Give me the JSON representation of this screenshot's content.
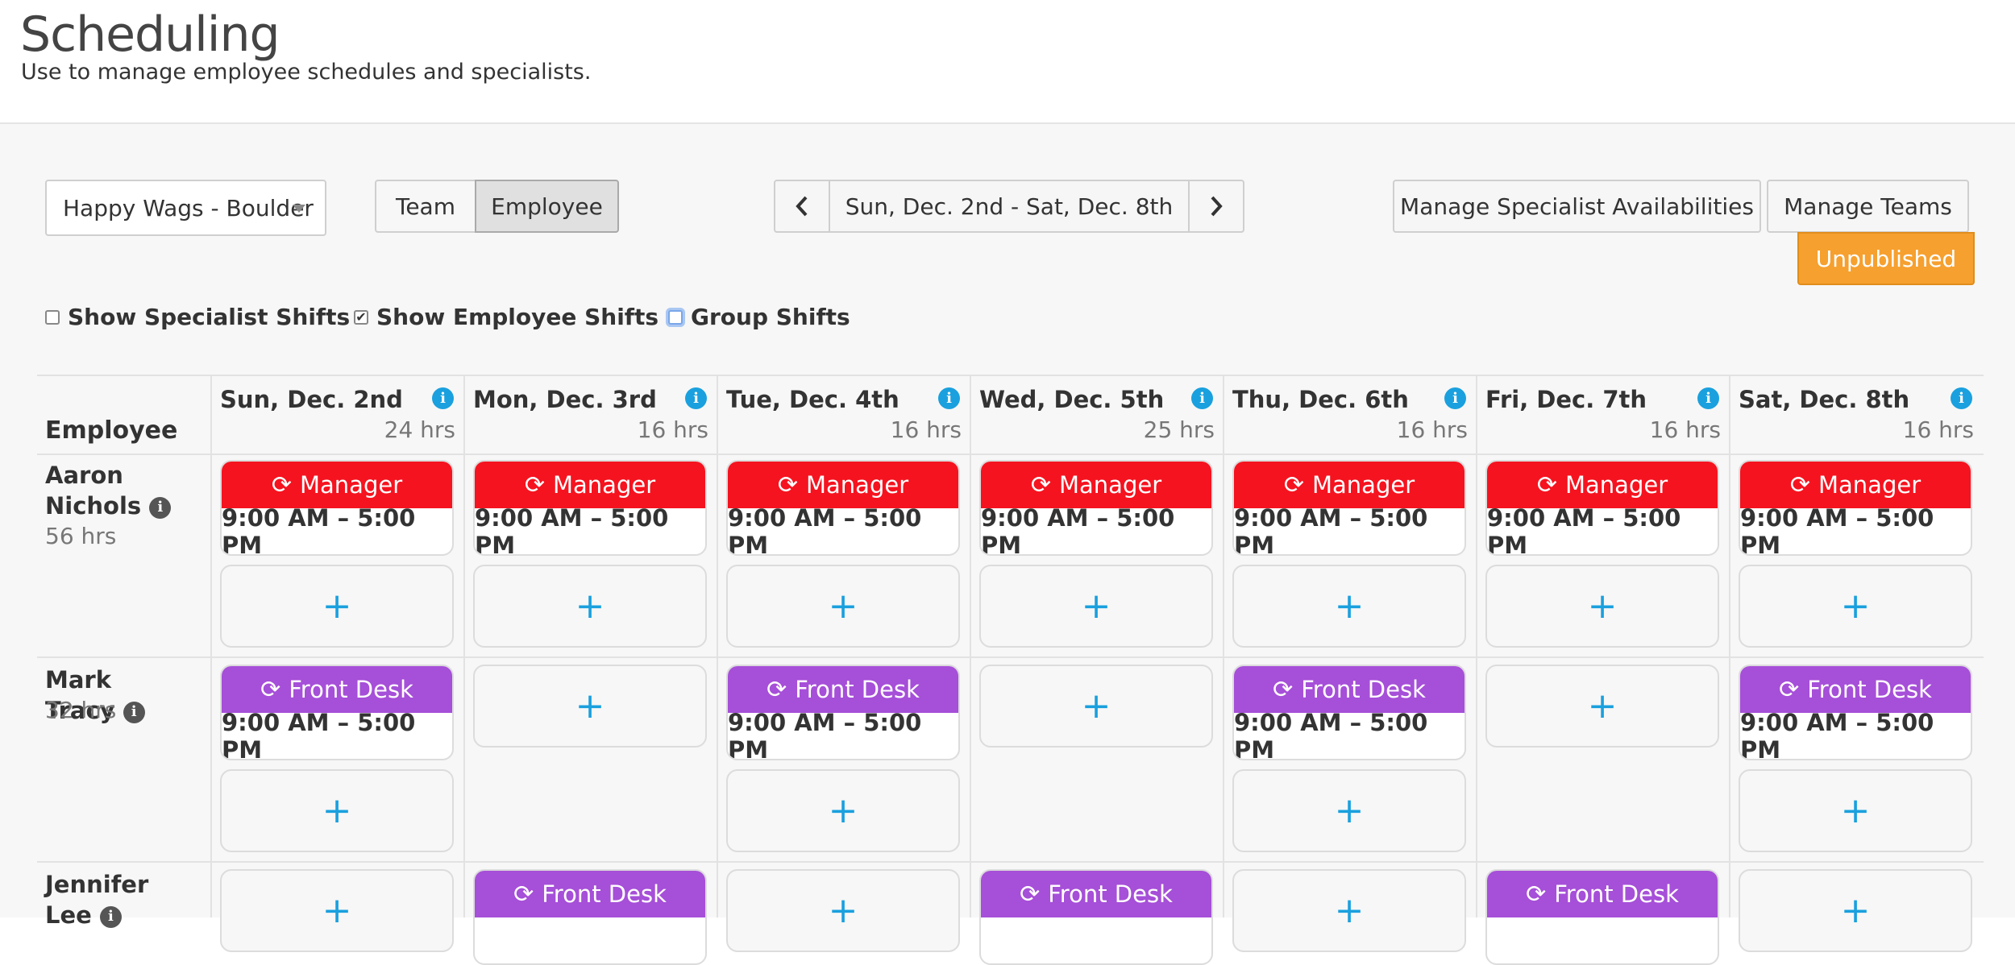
{
  "header": {
    "title": "Scheduling",
    "subtitle": "Use to manage employee schedules and specialists."
  },
  "controls": {
    "location": "Happy Wags - Boulder",
    "view_toggle": [
      "Team",
      "Employee"
    ],
    "active_view": "Employee",
    "date_range": "Sun, Dec. 2nd - Sat, Dec. 8th",
    "manage_specialist": "Manage Specialist Availabilities",
    "manage_teams": "Manage Teams",
    "status": "Unpublished"
  },
  "filters": [
    {
      "label": "Show Specialist Shifts",
      "checked": false
    },
    {
      "label": "Show Employee Shifts",
      "checked": true
    },
    {
      "label": "Group Shifts",
      "checked": false
    }
  ],
  "grid": {
    "employee_header": "Employee",
    "days": [
      {
        "label": "Sun, Dec. 2nd",
        "hours": "24 hrs"
      },
      {
        "label": "Mon, Dec. 3rd",
        "hours": "16 hrs"
      },
      {
        "label": "Tue, Dec. 4th",
        "hours": "16 hrs"
      },
      {
        "label": "Wed, Dec. 5th",
        "hours": "25 hrs"
      },
      {
        "label": "Thu, Dec. 6th",
        "hours": "16 hrs"
      },
      {
        "label": "Fri, Dec. 7th",
        "hours": "16 hrs"
      },
      {
        "label": "Sat, Dec. 8th",
        "hours": "16 hrs"
      }
    ],
    "rows": [
      {
        "name": "Aaron Nichols",
        "hours": "56 hrs",
        "shifts": [
          {
            "role": "Manager",
            "time": "9:00 AM – 5:00 PM"
          },
          {
            "role": "Manager",
            "time": "9:00 AM – 5:00 PM"
          },
          {
            "role": "Manager",
            "time": "9:00 AM – 5:00 PM"
          },
          {
            "role": "Manager",
            "time": "9:00 AM – 5:00 PM"
          },
          {
            "role": "Manager",
            "time": "9:00 AM – 5:00 PM"
          },
          {
            "role": "Manager",
            "time": "9:00 AM – 5:00 PM"
          },
          {
            "role": "Manager",
            "time": "9:00 AM – 5:00 PM"
          }
        ]
      },
      {
        "name": "Mark Tracy",
        "hours": "32 hrs",
        "shifts": [
          {
            "role": "Front Desk",
            "time": "9:00 AM – 5:00 PM"
          },
          null,
          {
            "role": "Front Desk",
            "time": "9:00 AM – 5:00 PM"
          },
          null,
          {
            "role": "Front Desk",
            "time": "9:00 AM – 5:00 PM"
          },
          null,
          {
            "role": "Front Desk",
            "time": "9:00 AM – 5:00 PM"
          }
        ]
      },
      {
        "name": "Jennifer Lee",
        "hours": "",
        "shifts": [
          null,
          {
            "role": "Front Desk",
            "time": ""
          },
          null,
          {
            "role": "Front Desk",
            "time": ""
          },
          null,
          {
            "role": "Front Desk",
            "time": ""
          },
          null
        ]
      }
    ],
    "add_symbol": "+",
    "shift_icon": "refresh-icon"
  },
  "colors": {
    "manager": "#f5131f",
    "front_desk": "#a64fd8",
    "accent": "#1aa0de",
    "unpublished": "#f6a02f"
  }
}
